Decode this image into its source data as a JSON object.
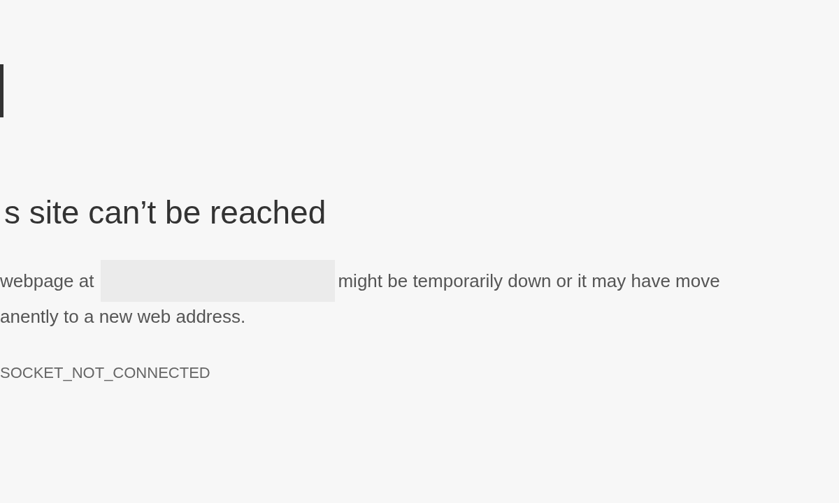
{
  "heading": "s site can’t be reached",
  "message": {
    "before_address": "webpage at",
    "after_address": "might be temporarily down or it may have move",
    "line_2": "anently to a new web address."
  },
  "error_code": "SOCKET_NOT_CONNECTED"
}
